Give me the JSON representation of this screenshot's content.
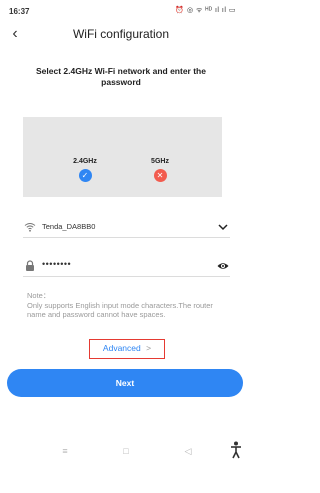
{
  "status_bar": {
    "time": "16:37",
    "icons_text": "⏰ ◎ ᯤ ᴴᴰ ıl ıl ▭",
    "icons": [
      "alarm-icon",
      "eye-comfort-icon",
      "wifi-icon",
      "hd-icon",
      "signal-icon",
      "signal-icon",
      "battery-icon"
    ]
  },
  "header": {
    "back_icon": "chevron-left-icon",
    "back_glyph": "‹",
    "title": "WiFi configuration"
  },
  "instruction": "Select 2.4GHz Wi-Fi network and enter the password",
  "illustration": {
    "band_24": {
      "label": "2.4GHz",
      "mark": "✓",
      "status": "supported"
    },
    "band_5": {
      "label": "5GHz",
      "mark": "✕",
      "status": "not supported"
    }
  },
  "ssid_field": {
    "icon": "wifi-icon",
    "value": "Tenda_DA8BB0",
    "action_icon": "chevron-down-icon"
  },
  "password_field": {
    "icon": "lock-icon",
    "value": "••••••••",
    "action_icon": "eye-icon"
  },
  "note": {
    "heading": "Note：",
    "body": "Only supports English input mode characters.The router name and password cannot have spaces."
  },
  "advanced": {
    "label": "Advanced",
    "arrow": ">"
  },
  "next_button": {
    "label": "Next"
  },
  "nav_bar": {
    "menu_glyph": "≡",
    "home_glyph": "□",
    "back_glyph": "◁"
  },
  "colors": {
    "accent": "#2f86f3",
    "error": "#f25c4f",
    "highlight_border": "#e53a32",
    "note_text": "#9a9a9a"
  }
}
